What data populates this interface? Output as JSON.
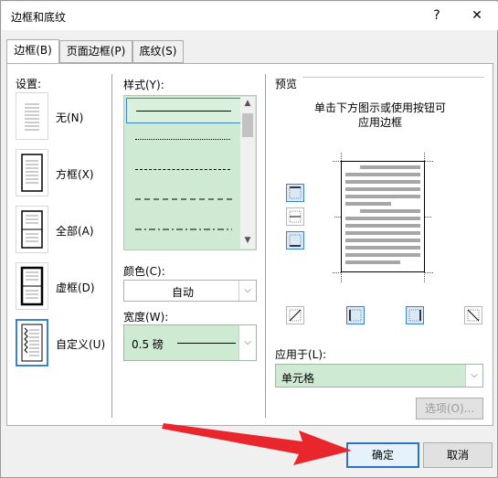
{
  "window": {
    "title": "边框和底纹",
    "help": "?",
    "close": "✕"
  },
  "tabs": [
    {
      "label": "边框(B)"
    },
    {
      "label": "页面边框(P)"
    },
    {
      "label": "底纹(S)"
    }
  ],
  "settings": {
    "heading": "设置:",
    "items": [
      {
        "label": "无(N)"
      },
      {
        "label": "方框(X)"
      },
      {
        "label": "全部(A)"
      },
      {
        "label": "虚框(D)"
      },
      {
        "label": "自定义(U)"
      }
    ]
  },
  "style": {
    "label": "样式(Y):"
  },
  "color": {
    "label": "颜色(C):",
    "value": "自动"
  },
  "width": {
    "label": "宽度(W):",
    "value": "0.5 磅"
  },
  "preview": {
    "heading": "预览",
    "instructions_line1": "单击下方图示或使用按钮可",
    "instructions_line2": "应用边框"
  },
  "apply_to": {
    "label": "应用于(L):",
    "value": "单元格"
  },
  "buttons": {
    "options": "选项(O)...",
    "ok": "确定",
    "cancel": "取消"
  },
  "colors": {
    "selection_green": "#cfead3",
    "accent_blue": "#3b83c9",
    "arrow_red": "#e8262b"
  }
}
